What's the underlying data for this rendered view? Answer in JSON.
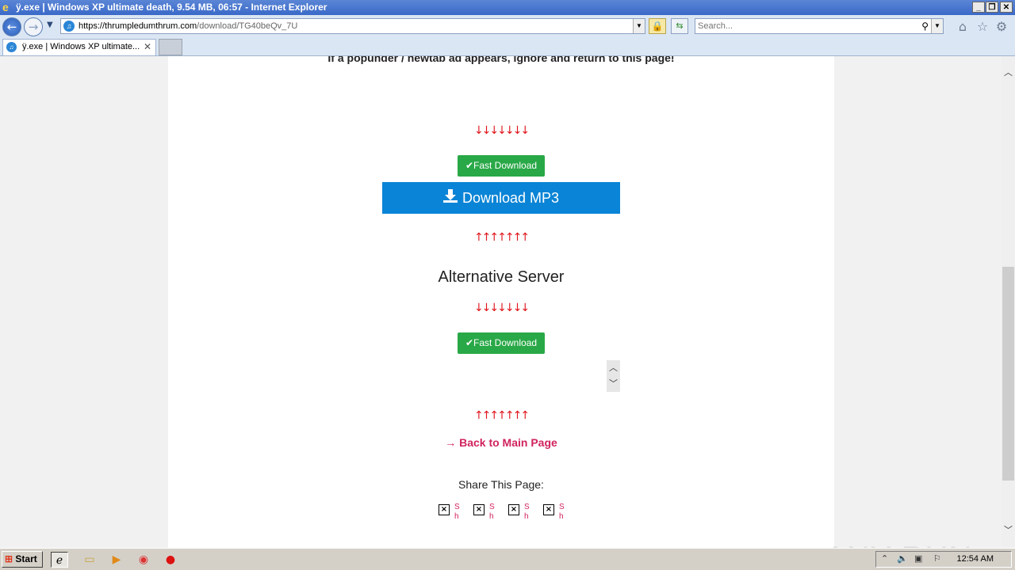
{
  "window": {
    "title": "ÿ.exe | Windows XP ultimate death, 9.54 MB, 06:57 - Internet Explorer",
    "minimize": "_",
    "restore": "❐",
    "close": "✕"
  },
  "navbar": {
    "url_host": "https://thrumpledumthrum.com",
    "url_path": "/download/TG40beQv_7U",
    "search_placeholder": "Search..."
  },
  "tabs": [
    {
      "label": "ÿ.exe | Windows XP ultimate..."
    }
  ],
  "page": {
    "notice": "If a popunder / newtab ad appears, ignore and return to this page!",
    "arrows_down": "↓↓↓↓↓↓↓",
    "arrows_up": "↑↑↑↑↑↑↑",
    "fast_download": "✔Fast Download",
    "download_mp3": "Download MP3",
    "alternative_server": "Alternative Server",
    "back_link": "→ Back to Main Page",
    "share_label": "Share This Page:",
    "share_items": [
      "S h",
      "S h",
      "S h",
      "S h"
    ]
  },
  "watermark": "ANY RUN",
  "taskbar": {
    "start": "Start",
    "clock": "12:54 AM"
  },
  "colors": {
    "fast_download_bg": "#29a847",
    "download_mp3_bg": "#0a84d6",
    "arrows": "#e0161d",
    "back_link": "#d1235e"
  }
}
